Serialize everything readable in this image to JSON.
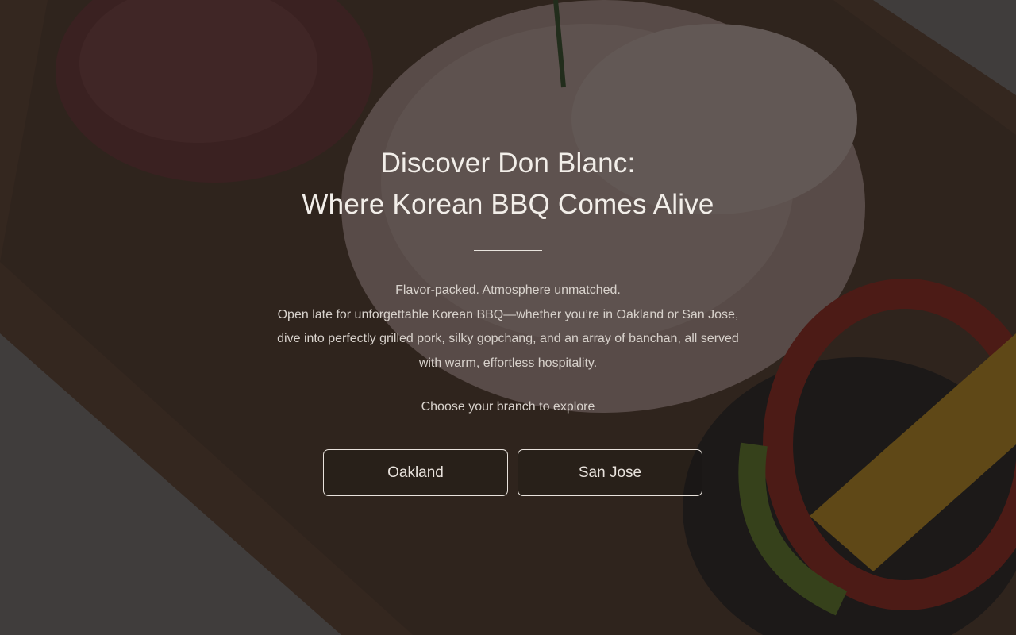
{
  "hero": {
    "title_line1": "Discover Don Blanc:",
    "title_line2": "Where Korean BBQ Comes Alive",
    "tagline": "Flavor-packed. Atmosphere unmatched.",
    "description": "Open late for unforgettable Korean BBQ—whether you’re in Oakland or San Jose, dive into perfectly grilled pork, silky gopchang, and an array of banchan, all served with warm, effortless hospitality.",
    "choose_prompt": "Choose your branch to explore"
  },
  "branches": {
    "oakland_label": "Oakland",
    "sanjose_label": "San Jose"
  },
  "colors": {
    "overlay": "#141211",
    "text": "#f2eee9",
    "button_border": "#e8e2dc"
  }
}
